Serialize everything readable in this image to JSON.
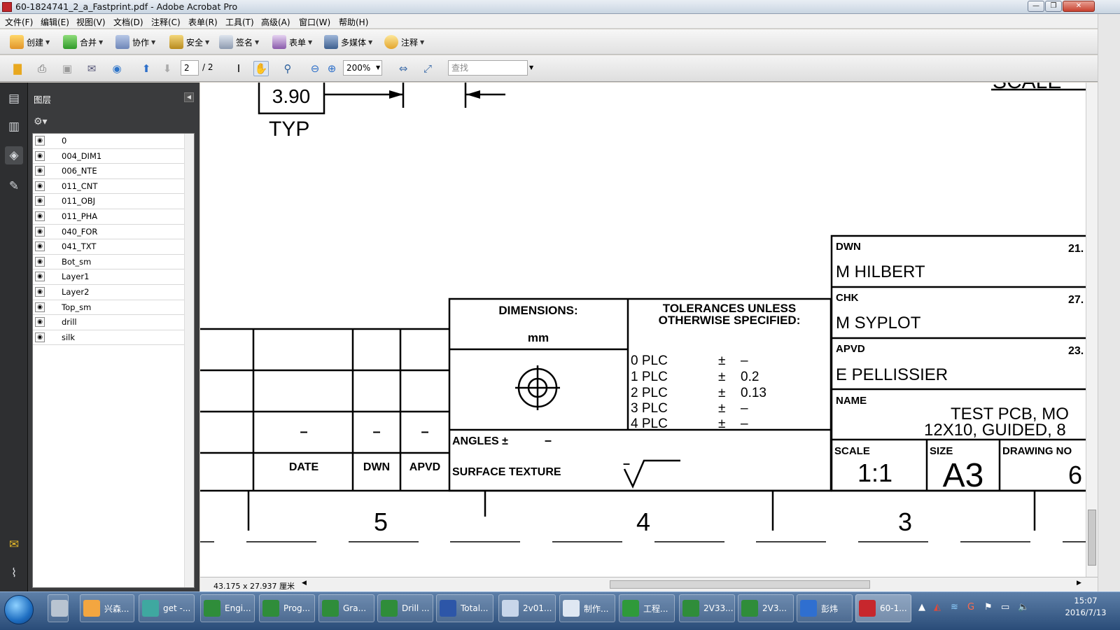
{
  "window": {
    "title": "60-1824741_2_a_Fastprint.pdf - Adobe Acrobat Pro"
  },
  "menu": [
    "文件(F)",
    "编辑(E)",
    "视图(V)",
    "文档(D)",
    "注释(C)",
    "表单(R)",
    "工具(T)",
    "高级(A)",
    "窗口(W)",
    "帮助(H)"
  ],
  "toolbar1": [
    "创建",
    "合并",
    "协作",
    "安全",
    "签名",
    "表单",
    "多媒体",
    "注释"
  ],
  "toolbar2": {
    "page_current": "2",
    "page_total": "/ 2",
    "zoom": "200%",
    "search_placeholder": "查找"
  },
  "panel": {
    "title": "图层",
    "layers": [
      "0",
      "004_DIM1",
      "006_NTE",
      "011_CNT",
      "011_OBJ",
      "011_PHA",
      "040_FOR",
      "041_TXT",
      "Bot_sm",
      "Layer1",
      "Layer2",
      "Top_sm",
      "drill",
      "silk"
    ]
  },
  "drawing": {
    "dim_value": "3.90",
    "dim_typ": "TYP",
    "scale_top": "SCALE",
    "dimensions_label": "DIMENSIONS:",
    "dimensions_unit": "mm",
    "tol_title_1": "TOLERANCES UNLESS",
    "tol_title_2": "OTHERWISE SPECIFIED:",
    "tolerances": [
      {
        "plc": "0  PLC",
        "pm": "±",
        "val": "–"
      },
      {
        "plc": "1  PLC",
        "pm": "±",
        "val": "0.2"
      },
      {
        "plc": "2  PLC",
        "pm": "±",
        "val": "0.13"
      },
      {
        "plc": "3  PLC",
        "pm": "±",
        "val": "–"
      },
      {
        "plc": "4  PLC",
        "pm": "±",
        "val": "–"
      }
    ],
    "angles_label": "ANGLES ±",
    "angles_val": "–",
    "surface_label": "SURFACE TEXTURE",
    "surface_dash": "–",
    "rev_dash_1": "–",
    "rev_dash_2": "–",
    "rev_dash_3": "–",
    "rev_date": "DATE",
    "rev_dwn": "DWN",
    "rev_apvd": "APVD",
    "dwn_label": "DWN",
    "dwn_name": "M  HILBERT",
    "dwn_date": "21.",
    "chk_label": "CHK",
    "chk_name": "M  SYPLOT",
    "chk_date": "27.",
    "apvd_label": "APVD",
    "apvd_name": "E  PELLISSIER",
    "apvd_date": "23.",
    "name_label": "NAME",
    "name_line1": "TEST  PCB,  MO",
    "name_line2": "12X10,  GUIDED,  8",
    "scale_label": "SCALE",
    "scale_value": "1:1",
    "size_label": "SIZE",
    "size_value": "A3",
    "drawing_no_label": "DRAWING  NO",
    "drawing_no_value": "6",
    "zone_5": "5",
    "zone_4": "4",
    "zone_3": "3"
  },
  "status": {
    "page_size": "43.175 x 27.937 厘米"
  },
  "taskbar": {
    "items": [
      "兴森...",
      "get -...",
      "Engi...",
      "Prog...",
      "Gra...",
      "Drill ...",
      "Total...",
      "2v01...",
      "制作...",
      "工程...",
      "2V33...",
      "2V3...",
      "彭炜",
      "60-1..."
    ],
    "time": "15:07",
    "date": "2016/7/13"
  }
}
